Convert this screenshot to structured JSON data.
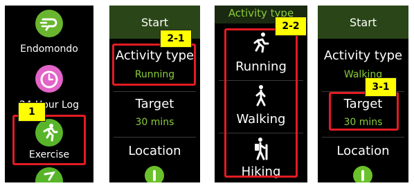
{
  "screen1": {
    "apps": [
      {
        "label": "Endomondo",
        "icon": "endomondo-icon",
        "color": "#6ab52f"
      },
      {
        "label": "24-Hour Log",
        "icon": "clock-log-icon",
        "color": "#e264c8"
      },
      {
        "label": "Exercise",
        "icon": "running-person-icon",
        "color": "#58b52a"
      },
      {
        "icon": "partial-app-icon",
        "color": "#58b52a"
      }
    ],
    "callout": "1"
  },
  "screen2": {
    "header": "Start",
    "activity_title": "Activity type",
    "activity_value": "Running",
    "target_title": "Target",
    "target_value": "30 mins",
    "location_title": "Location",
    "callout": "2-1"
  },
  "screen3": {
    "header": "Activity type",
    "activities": [
      {
        "label": "Running",
        "icon": "running-icon"
      },
      {
        "label": "Walking",
        "icon": "walking-icon"
      },
      {
        "label": "Hiking",
        "icon": "hiking-icon"
      }
    ],
    "callout": "2-2"
  },
  "screen4": {
    "header": "Start",
    "activity_title": "Activity type",
    "activity_value": "Walking",
    "target_title": "Target",
    "target_value": "30 mins",
    "location_title": "Location",
    "callout": "3-1"
  },
  "colors": {
    "accent_green": "#8acc3a",
    "header_green": "#2a4618",
    "highlight_red": "#e31b23",
    "callout_yellow": "#ffff00"
  }
}
